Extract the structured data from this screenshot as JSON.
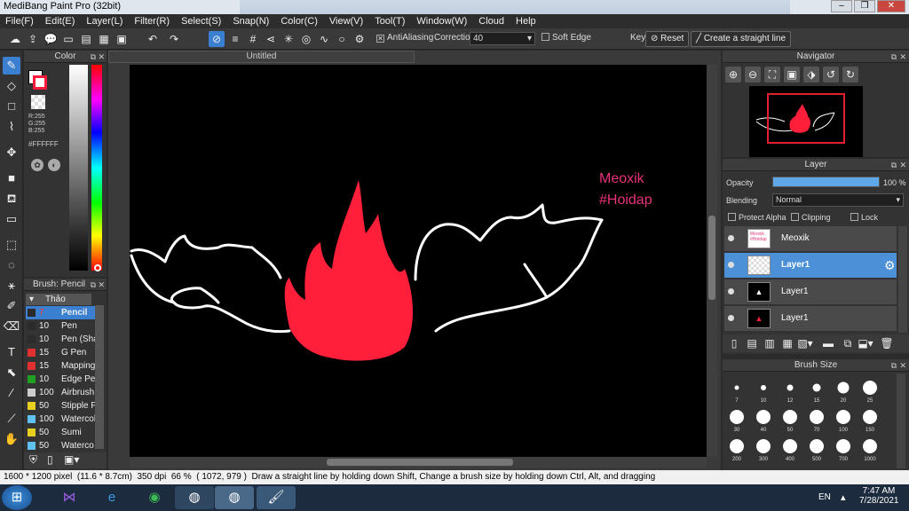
{
  "window": {
    "title": "MediBang Paint Pro (32bit)",
    "controls": [
      "–",
      "❐",
      "✕"
    ]
  },
  "menu": [
    "File(F)",
    "Edit(E)",
    "Layer(L)",
    "Filter(R)",
    "Select(S)",
    "Snap(N)",
    "Color(C)",
    "View(V)",
    "Tool(T)",
    "Window(W)",
    "Cloud",
    "Help"
  ],
  "toolbar": {
    "antialiasing_label": "AntiAliasing",
    "antialiasing_checked": true,
    "correction_label": "Correction",
    "correction_value": "40",
    "soft_edge_label": "Soft Edge",
    "soft_edge_checked": false,
    "key_label": "Key",
    "reset_label": "Reset",
    "straight_line_label": "Create a straight line"
  },
  "color_panel": {
    "title": "Color",
    "primary": "#FF1A3C",
    "rgb": [
      "R:255",
      "G:255",
      "B:255"
    ],
    "hex": "#FFFFFF"
  },
  "brush_panel": {
    "title": "Brush: Pencil",
    "group": "Thảo",
    "items": [
      {
        "size": "7",
        "name": "Pencil",
        "color": "#2b2b2b",
        "selected": true
      },
      {
        "size": "10",
        "name": "Pen",
        "color": "#2b2b2b"
      },
      {
        "size": "10",
        "name": "Pen (Sha",
        "color": "#2b2b2b"
      },
      {
        "size": "15",
        "name": "G Pen",
        "color": "#e03030"
      },
      {
        "size": "15",
        "name": "Mapping",
        "color": "#e03030"
      },
      {
        "size": "10",
        "name": "Edge Pen",
        "color": "#20a020"
      },
      {
        "size": "100",
        "name": "Airbrush",
        "color": "#cccccc"
      },
      {
        "size": "50",
        "name": "Stipple P",
        "color": "#e8d020"
      },
      {
        "size": "100",
        "name": "Watercol",
        "color": "#60c0f0"
      },
      {
        "size": "50",
        "name": "Sumi",
        "color": "#e8d020"
      },
      {
        "size": "50",
        "name": "Waterco",
        "color": "#60c0f0"
      }
    ]
  },
  "canvas": {
    "tab_title": "Untitled",
    "watermark_line1": "Meoxik",
    "watermark_line2": "#Hoidap",
    "flame_color": "#FF1F3A"
  },
  "navigator": {
    "title": "Navigator"
  },
  "layer_panel": {
    "title": "Layer",
    "opacity_label": "Opacity",
    "opacity_value": "100 %",
    "opacity_fraction": 1.0,
    "blending_label": "Blending",
    "blending_value": "Normal",
    "protect_alpha_label": "Protect Alpha",
    "clipping_label": "Clipping",
    "lock_label": "Lock",
    "layers": [
      {
        "name": "Meoxik",
        "thumb": "text"
      },
      {
        "name": "Layer1",
        "thumb": "transparent",
        "selected": true
      },
      {
        "name": "Layer1",
        "thumb": "black-white"
      },
      {
        "name": "Layer1",
        "thumb": "black-red"
      }
    ]
  },
  "brush_size_panel": {
    "title": "Brush Size",
    "sizes": [
      "7",
      "10",
      "12",
      "15",
      "20",
      "25",
      "30",
      "40",
      "50",
      "70",
      "100",
      "150",
      "200",
      "300",
      "400",
      "500",
      "700",
      "1000"
    ]
  },
  "status_bar": {
    "dimensions": "1600 * 1200 pixel",
    "physical": "(11.6 * 8.7cm)",
    "dpi": "350 dpi",
    "zoom": "66 %",
    "cursor": "( 1072, 979 )",
    "hint": "Draw a straight line by holding down Shift, Change a brush size by holding down Ctrl, Alt, and dragging"
  },
  "taskbar": {
    "language": "EN",
    "time": "7:47 AM",
    "date": "7/28/2021"
  }
}
